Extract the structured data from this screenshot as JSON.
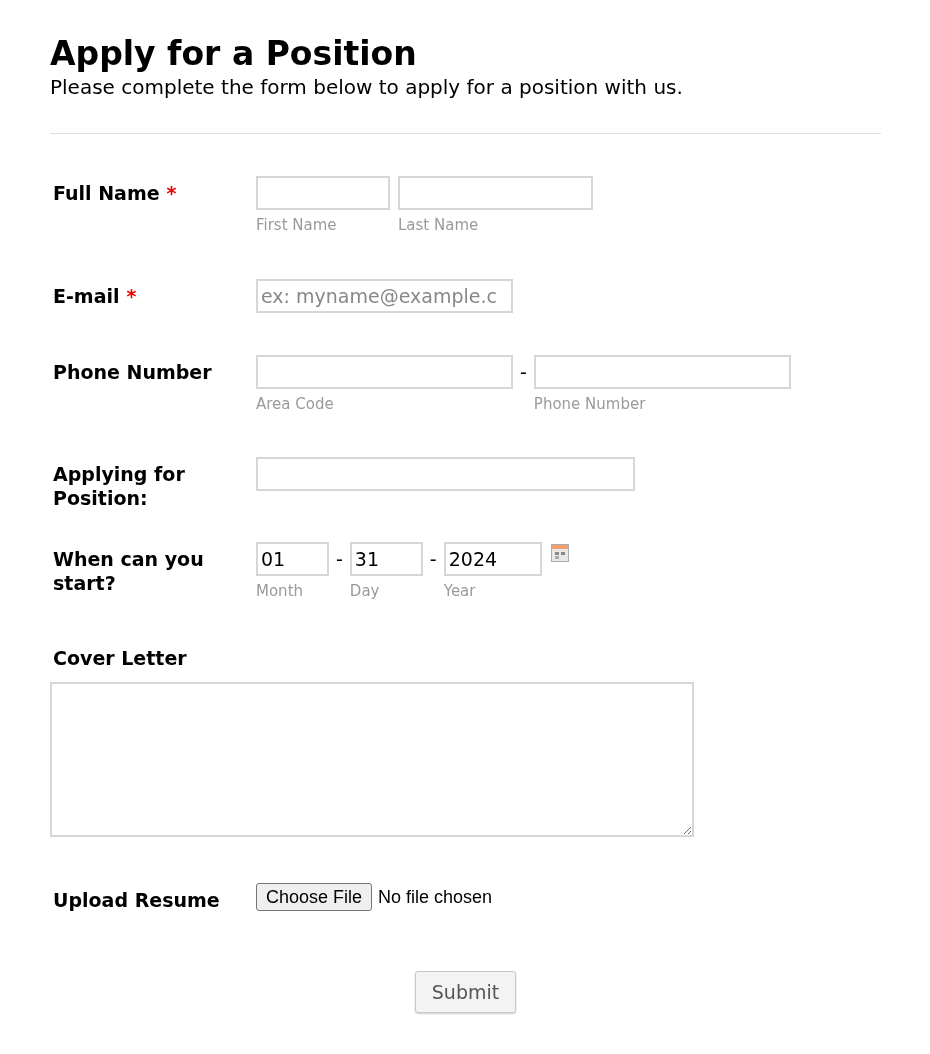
{
  "title": "Apply for a Position",
  "subtitle": "Please complete the form below to apply for a position with us.",
  "fields": [
    {
      "kind": "name",
      "label": "Full Name",
      "required_mark": "*",
      "parts": [
        {
          "sublabel": "First Name"
        },
        {
          "sublabel": "Last Name"
        }
      ]
    },
    {
      "kind": "email",
      "label": "E-mail",
      "required_mark": "*",
      "placeholder": "ex: myname@example.c"
    },
    {
      "kind": "phone",
      "label": "Phone Number",
      "separator": "-",
      "parts": [
        {
          "sublabel": "Area Code"
        },
        {
          "sublabel": "Phone Number"
        }
      ]
    },
    {
      "kind": "text",
      "label": "Applying for Position:"
    },
    {
      "kind": "date",
      "label": "When can you start?",
      "separator": "-",
      "parts": [
        {
          "value": "01",
          "sublabel": "Month"
        },
        {
          "value": "31",
          "sublabel": "Day"
        },
        {
          "value": "2024",
          "sublabel": "Year"
        }
      ]
    },
    {
      "kind": "textarea",
      "label": "Cover Letter"
    },
    {
      "kind": "file",
      "label": "Upload Resume",
      "button": "Choose File",
      "status": "No file chosen"
    }
  ],
  "submit": "Submit"
}
